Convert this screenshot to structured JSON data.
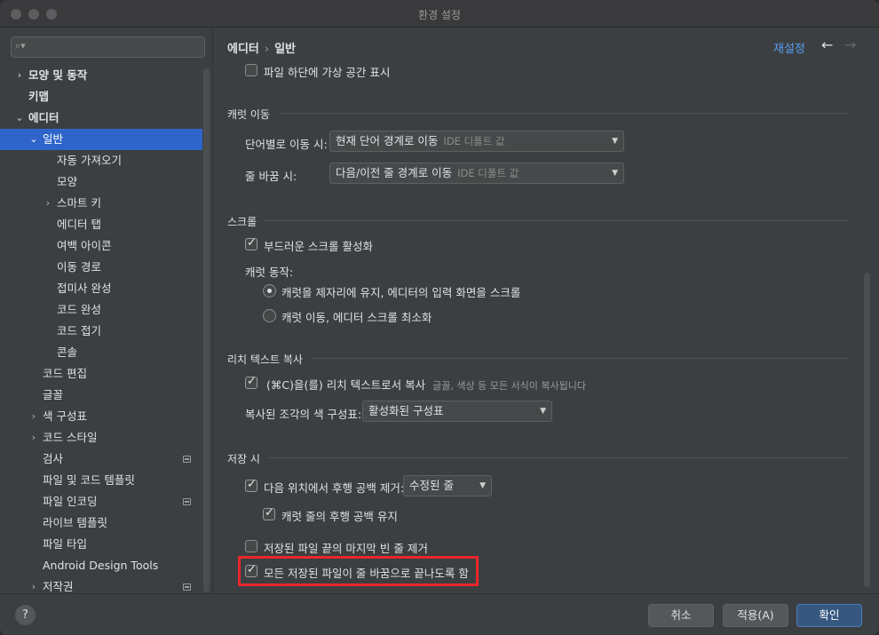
{
  "window": {
    "title": "환경 설정"
  },
  "sidebar": {
    "search_placeholder": "",
    "items": [
      {
        "label": "모양 및 동작",
        "chevron": "›",
        "bold": true
      },
      {
        "label": "키맵",
        "chevron": "",
        "bold": true
      },
      {
        "label": "에디터",
        "chevron": "⌄",
        "bold": true
      },
      {
        "label": "일반",
        "chevron": "⌄",
        "selected": true
      },
      {
        "label": "자동 가져오기"
      },
      {
        "label": "모양"
      },
      {
        "label": "스마트 키",
        "chevron": "›"
      },
      {
        "label": "에디터 탭"
      },
      {
        "label": "여백 아이콘"
      },
      {
        "label": "이동 경로"
      },
      {
        "label": "접미사 완성"
      },
      {
        "label": "코드 완성"
      },
      {
        "label": "코드 접기"
      },
      {
        "label": "콘솔"
      },
      {
        "label": "코드 편집"
      },
      {
        "label": "글꼴"
      },
      {
        "label": "색 구성표",
        "chevron": "›"
      },
      {
        "label": "코드 스타일",
        "chevron": "›"
      },
      {
        "label": "검사",
        "project_icon": true
      },
      {
        "label": "파일 및 코드 템플릿"
      },
      {
        "label": "파일 인코딩",
        "project_icon": true
      },
      {
        "label": "라이브 템플릿"
      },
      {
        "label": "파일 타입"
      },
      {
        "label": "Android Design Tools"
      },
      {
        "label": "저작권",
        "chevron": "›",
        "project_icon": true
      }
    ]
  },
  "header": {
    "breadcrumb": [
      "에디터",
      "일반"
    ],
    "breadcrumb_sep": "›",
    "reset_label": "재설정",
    "back_icon": "←",
    "forward_icon": "→"
  },
  "settings": {
    "virtual_space_label": "파일 하단에 가상 공간 표시",
    "caret_section": "캐럿 이동",
    "word_move_label": "단어별로 이동 시:",
    "word_move_value": "현재 단어 경계로 이동",
    "word_move_hint": "IDE 디폴트 값",
    "line_break_label": "줄 바꿈 시:",
    "line_break_value": "다음/이전 줄 경계로 이동",
    "line_break_hint": "IDE 디폴트 값",
    "scroll_section": "스크롤",
    "smooth_scroll_label": "부드러운 스크롤 활성화",
    "caret_behavior_label": "캐럿 동작:",
    "radio_keep": "캐럿을 제자리에 유지, 에디터의 입력 화면을 스크롤",
    "radio_move": "캐럿 이동, 에디터 스크롤 최소화",
    "rich_section": "리치 텍스트 복사",
    "rich_copy_label": "(⌘C)을(를) 리치 텍스트로서 복사",
    "rich_copy_hint": "글꼴, 색상 등 모든 서식이 복사됩니다",
    "color_scheme_label": "복사된 조각의 색 구성표:",
    "color_scheme_value": "활성화된 구성표",
    "save_section": "저장 시",
    "strip_label": "다음 위치에서 후행 공백 제거:",
    "strip_value": "수정된 줄",
    "keep_caret_ws_label": "캐럿 줄의 후행 공백 유지",
    "remove_blank_label": "저장된 파일 끝의 마지막 빈 줄 제거",
    "ensure_newline_label": "모든 저장된 파일이 줄 바꿈으로 끝나도록 함"
  },
  "footer": {
    "help": "?",
    "cancel": "취소",
    "apply": "적용(A)",
    "ok": "확인"
  },
  "colors": {
    "accent": "#2f65ca",
    "link": "#589df6",
    "highlight_border": "#e8262b"
  }
}
